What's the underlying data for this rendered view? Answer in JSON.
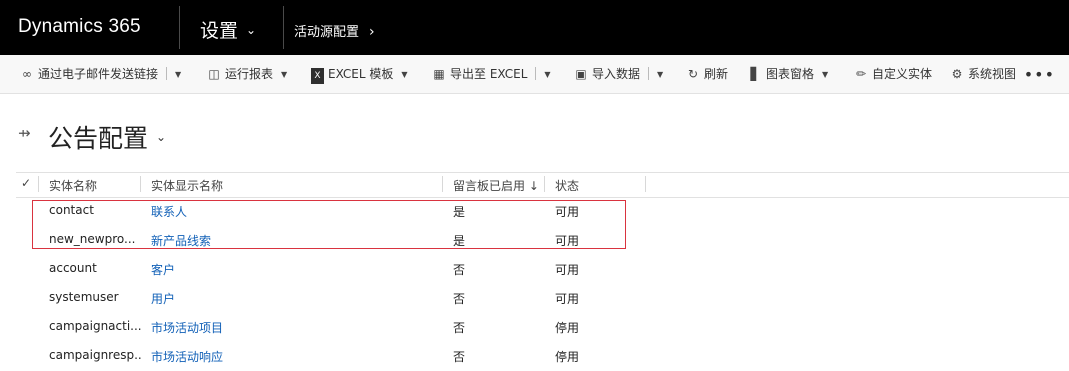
{
  "topbar": {
    "brand": "Dynamics 365",
    "area": "设置",
    "breadcrumb": "活动源配置"
  },
  "commands": [
    {
      "label": "通过电子邮件发送链接",
      "icon": "link-icon"
    },
    {
      "label": "运行报表",
      "icon": "report-icon"
    },
    {
      "label": "EXCEL 模板",
      "icon": "excel-icon"
    },
    {
      "label": "导出至 EXCEL",
      "icon": "export-excel-icon"
    },
    {
      "label": "导入数据",
      "icon": "import-data-icon"
    },
    {
      "label": "刷新",
      "icon": "refresh-icon"
    },
    {
      "label": "图表窗格",
      "icon": "chart-icon"
    },
    {
      "label": "自定义实体",
      "icon": "customize-entity-icon"
    },
    {
      "label": "系统视图",
      "icon": "gear-icon"
    }
  ],
  "view": {
    "title": "公告配置"
  },
  "grid": {
    "columns": [
      "实体名称",
      "实体显示名称",
      "留言板已启用",
      "状态"
    ],
    "sort_indicator": "↓",
    "rows": [
      {
        "name": "contact",
        "display": "联系人",
        "wall": "是",
        "status": "可用"
      },
      {
        "name": "new_newpro...",
        "display": "新产品线索",
        "wall": "是",
        "status": "可用"
      },
      {
        "name": "account",
        "display": "客户",
        "wall": "否",
        "status": "可用"
      },
      {
        "name": "systemuser",
        "display": "用户",
        "wall": "否",
        "status": "可用"
      },
      {
        "name": "campaignacti...",
        "display": "市场活动项目",
        "wall": "否",
        "status": "停用"
      },
      {
        "name": "campaignresp...",
        "display": "市场活动响应",
        "wall": "否",
        "status": "停用"
      }
    ]
  }
}
